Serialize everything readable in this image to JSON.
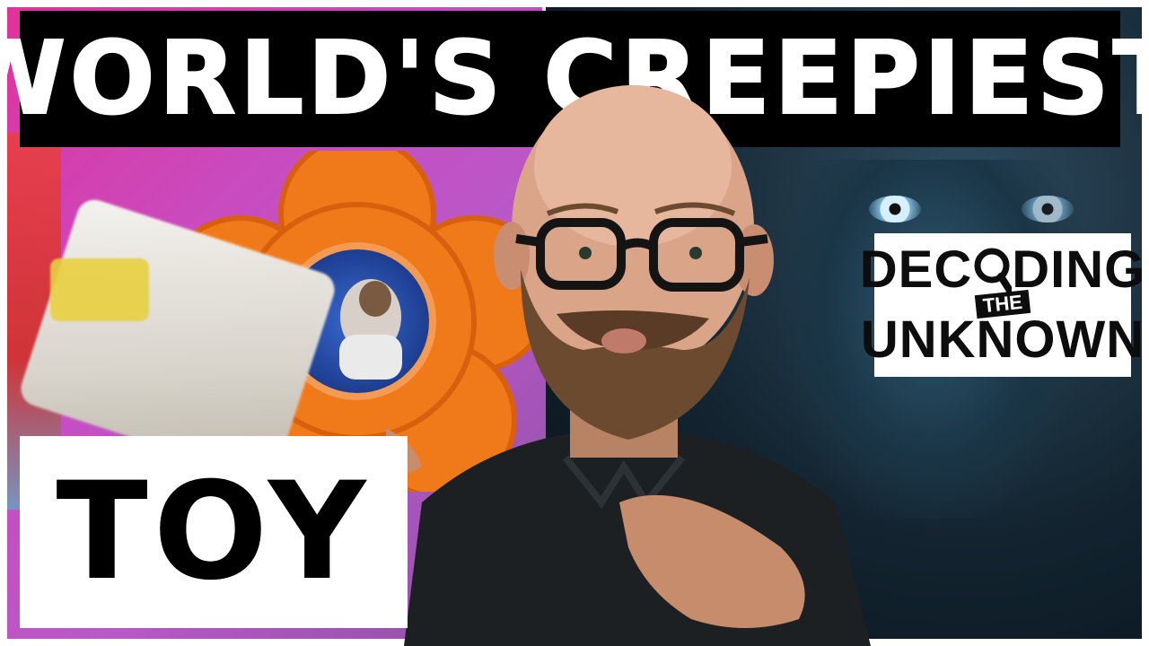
{
  "title": "WORLD'S CREEPIEST",
  "label": "TOY",
  "logo": {
    "line1_a": "DEC",
    "line1_b": "DING",
    "the": "THE",
    "line2": "UNKNOWN"
  },
  "colors": {
    "title_band": "#000000",
    "title_text": "#ffffff",
    "label_box": "#ffffff",
    "label_text": "#000000",
    "toy_flower": "#f07a1a",
    "toy_pink": "#d83aa0"
  },
  "icons": [
    "magnifying-glass-icon"
  ]
}
